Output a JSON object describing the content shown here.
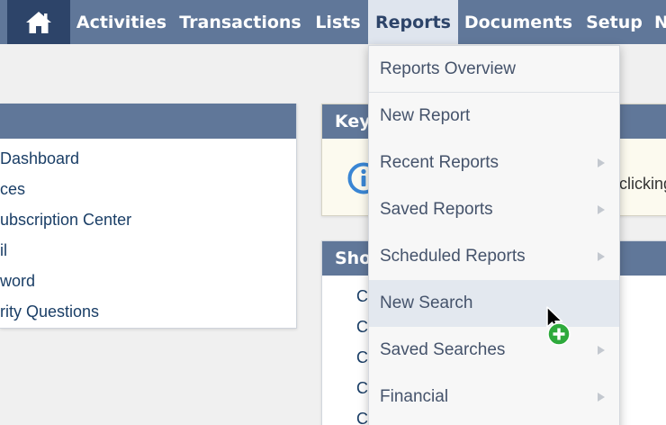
{
  "nav": {
    "home_icon": "home-icon",
    "items": [
      {
        "label": "Activities"
      },
      {
        "label": "Transactions"
      },
      {
        "label": "Lists"
      },
      {
        "label": "Reports"
      },
      {
        "label": "Documents"
      },
      {
        "label": "Setup"
      },
      {
        "label": "N"
      }
    ],
    "active_item": "Reports"
  },
  "left_panel": {
    "links": [
      {
        "label": "Dashboard"
      },
      {
        "label": "ces"
      },
      {
        "label": "ubscription Center"
      },
      {
        "label": "il"
      },
      {
        "label": "word"
      },
      {
        "label": "rity Questions"
      }
    ]
  },
  "key_panel": {
    "title": "Key",
    "icon": "info-icon",
    "text": "clicking"
  },
  "short_panel": {
    "title": "Sho",
    "links": [
      {
        "label": "C"
      },
      {
        "label": "C"
      },
      {
        "label": "C"
      },
      {
        "label": "C"
      },
      {
        "label": "C"
      }
    ]
  },
  "reports_menu": {
    "items": [
      {
        "label": "Reports Overview",
        "has_submenu": false
      },
      {
        "label": "New Report",
        "has_submenu": false
      },
      {
        "label": "Recent Reports",
        "has_submenu": true
      },
      {
        "label": "Saved Reports",
        "has_submenu": true
      },
      {
        "label": "Scheduled Reports",
        "has_submenu": true
      },
      {
        "label": "New Search",
        "has_submenu": false
      },
      {
        "label": "Saved Searches",
        "has_submenu": true
      },
      {
        "label": "Financial",
        "has_submenu": true
      }
    ],
    "hovered_item": "New Search"
  },
  "cursor": {
    "icon": "arrow-cursor-icon",
    "badge_icon": "plus-badge-icon"
  },
  "colors": {
    "nav_bg": "#607799",
    "home_bg": "#2d4469",
    "active_tab_bg": "#dfe5ee",
    "link_text": "#1a3e66",
    "menu_text": "#45536b",
    "menu_hover": "#e3e8ef",
    "key_panel_bg": "#fcfaef",
    "info_icon": "#3a86d4",
    "plus_badge": "#2eaa3c"
  }
}
